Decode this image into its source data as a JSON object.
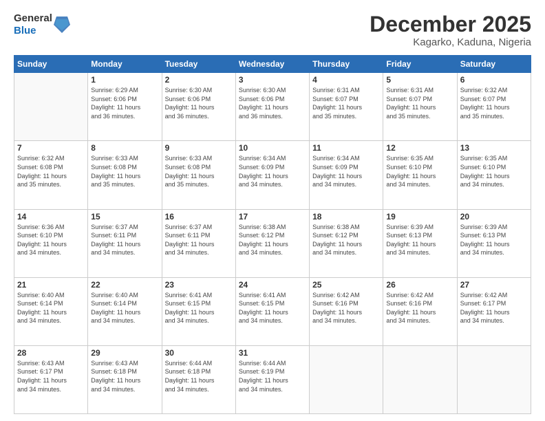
{
  "header": {
    "logo_line1": "General",
    "logo_line2": "Blue",
    "month_year": "December 2025",
    "location": "Kagarko, Kaduna, Nigeria"
  },
  "days_of_week": [
    "Sunday",
    "Monday",
    "Tuesday",
    "Wednesday",
    "Thursday",
    "Friday",
    "Saturday"
  ],
  "weeks": [
    [
      {
        "day": "",
        "info": ""
      },
      {
        "day": "1",
        "info": "Sunrise: 6:29 AM\nSunset: 6:06 PM\nDaylight: 11 hours\nand 36 minutes."
      },
      {
        "day": "2",
        "info": "Sunrise: 6:30 AM\nSunset: 6:06 PM\nDaylight: 11 hours\nand 36 minutes."
      },
      {
        "day": "3",
        "info": "Sunrise: 6:30 AM\nSunset: 6:06 PM\nDaylight: 11 hours\nand 36 minutes."
      },
      {
        "day": "4",
        "info": "Sunrise: 6:31 AM\nSunset: 6:07 PM\nDaylight: 11 hours\nand 35 minutes."
      },
      {
        "day": "5",
        "info": "Sunrise: 6:31 AM\nSunset: 6:07 PM\nDaylight: 11 hours\nand 35 minutes."
      },
      {
        "day": "6",
        "info": "Sunrise: 6:32 AM\nSunset: 6:07 PM\nDaylight: 11 hours\nand 35 minutes."
      }
    ],
    [
      {
        "day": "7",
        "info": "Sunrise: 6:32 AM\nSunset: 6:08 PM\nDaylight: 11 hours\nand 35 minutes."
      },
      {
        "day": "8",
        "info": "Sunrise: 6:33 AM\nSunset: 6:08 PM\nDaylight: 11 hours\nand 35 minutes."
      },
      {
        "day": "9",
        "info": "Sunrise: 6:33 AM\nSunset: 6:08 PM\nDaylight: 11 hours\nand 35 minutes."
      },
      {
        "day": "10",
        "info": "Sunrise: 6:34 AM\nSunset: 6:09 PM\nDaylight: 11 hours\nand 34 minutes."
      },
      {
        "day": "11",
        "info": "Sunrise: 6:34 AM\nSunset: 6:09 PM\nDaylight: 11 hours\nand 34 minutes."
      },
      {
        "day": "12",
        "info": "Sunrise: 6:35 AM\nSunset: 6:10 PM\nDaylight: 11 hours\nand 34 minutes."
      },
      {
        "day": "13",
        "info": "Sunrise: 6:35 AM\nSunset: 6:10 PM\nDaylight: 11 hours\nand 34 minutes."
      }
    ],
    [
      {
        "day": "14",
        "info": "Sunrise: 6:36 AM\nSunset: 6:10 PM\nDaylight: 11 hours\nand 34 minutes."
      },
      {
        "day": "15",
        "info": "Sunrise: 6:37 AM\nSunset: 6:11 PM\nDaylight: 11 hours\nand 34 minutes."
      },
      {
        "day": "16",
        "info": "Sunrise: 6:37 AM\nSunset: 6:11 PM\nDaylight: 11 hours\nand 34 minutes."
      },
      {
        "day": "17",
        "info": "Sunrise: 6:38 AM\nSunset: 6:12 PM\nDaylight: 11 hours\nand 34 minutes."
      },
      {
        "day": "18",
        "info": "Sunrise: 6:38 AM\nSunset: 6:12 PM\nDaylight: 11 hours\nand 34 minutes."
      },
      {
        "day": "19",
        "info": "Sunrise: 6:39 AM\nSunset: 6:13 PM\nDaylight: 11 hours\nand 34 minutes."
      },
      {
        "day": "20",
        "info": "Sunrise: 6:39 AM\nSunset: 6:13 PM\nDaylight: 11 hours\nand 34 minutes."
      }
    ],
    [
      {
        "day": "21",
        "info": "Sunrise: 6:40 AM\nSunset: 6:14 PM\nDaylight: 11 hours\nand 34 minutes."
      },
      {
        "day": "22",
        "info": "Sunrise: 6:40 AM\nSunset: 6:14 PM\nDaylight: 11 hours\nand 34 minutes."
      },
      {
        "day": "23",
        "info": "Sunrise: 6:41 AM\nSunset: 6:15 PM\nDaylight: 11 hours\nand 34 minutes."
      },
      {
        "day": "24",
        "info": "Sunrise: 6:41 AM\nSunset: 6:15 PM\nDaylight: 11 hours\nand 34 minutes."
      },
      {
        "day": "25",
        "info": "Sunrise: 6:42 AM\nSunset: 6:16 PM\nDaylight: 11 hours\nand 34 minutes."
      },
      {
        "day": "26",
        "info": "Sunrise: 6:42 AM\nSunset: 6:16 PM\nDaylight: 11 hours\nand 34 minutes."
      },
      {
        "day": "27",
        "info": "Sunrise: 6:42 AM\nSunset: 6:17 PM\nDaylight: 11 hours\nand 34 minutes."
      }
    ],
    [
      {
        "day": "28",
        "info": "Sunrise: 6:43 AM\nSunset: 6:17 PM\nDaylight: 11 hours\nand 34 minutes."
      },
      {
        "day": "29",
        "info": "Sunrise: 6:43 AM\nSunset: 6:18 PM\nDaylight: 11 hours\nand 34 minutes."
      },
      {
        "day": "30",
        "info": "Sunrise: 6:44 AM\nSunset: 6:18 PM\nDaylight: 11 hours\nand 34 minutes."
      },
      {
        "day": "31",
        "info": "Sunrise: 6:44 AM\nSunset: 6:19 PM\nDaylight: 11 hours\nand 34 minutes."
      },
      {
        "day": "",
        "info": ""
      },
      {
        "day": "",
        "info": ""
      },
      {
        "day": "",
        "info": ""
      }
    ]
  ]
}
